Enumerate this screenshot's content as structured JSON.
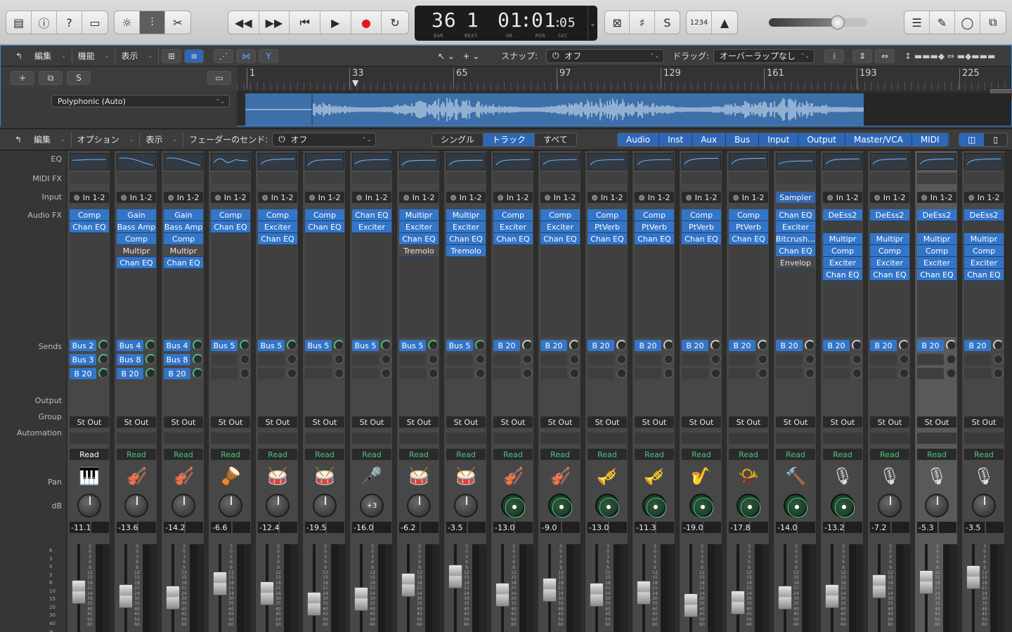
{
  "transport": {
    "bar": "36",
    "beat": "1",
    "time_hr": "01",
    "time_min": "01",
    "time_sec": "05",
    "label_bar": "BAR",
    "label_beat": "BEAT",
    "label_hr": "HR",
    "label_min": "MIN",
    "label_sec": "SEC",
    "counter": "1234"
  },
  "editor_bar": {
    "edit": "編集",
    "function": "機能",
    "view": "表示",
    "snap_label": "スナップ:",
    "snap_value": "オフ",
    "drag_label": "ドラッグ:",
    "drag_value": "オーバーラップなし"
  },
  "ruler": [
    "1",
    "33",
    "65",
    "97",
    "129",
    "161",
    "193",
    "225"
  ],
  "track": {
    "mode": "Polyphonic (Auto)",
    "s": "S"
  },
  "mixer_bar": {
    "edit": "編集",
    "options": "オプション",
    "view": "表示",
    "fader_send_label": "フェーダーのセンド:",
    "fader_send_value": "オフ",
    "views": [
      "シングル",
      "トラック",
      "すべて"
    ],
    "active_view": 1,
    "filters": [
      "Audio",
      "Inst",
      "Aux",
      "Bus",
      "Input",
      "Output",
      "Master/VCA",
      "MIDI"
    ]
  },
  "row_labels": {
    "eq": "EQ",
    "midifx": "MIDI FX",
    "input": "Input",
    "audiofx": "Audio FX",
    "sends": "Sends",
    "output": "Output",
    "group": "Group",
    "automation": "Automation",
    "pan": "Pan",
    "db": "dB"
  },
  "fader_scale": [
    "6",
    "3",
    "0",
    "3",
    "6",
    "10",
    "15",
    "20",
    "30",
    "40",
    "∞"
  ],
  "strip_scale": [
    "3",
    "0",
    "3",
    "6",
    "9",
    "12",
    "15",
    "18",
    "21",
    "24",
    "30",
    "35",
    "40",
    "45",
    "50",
    "60"
  ],
  "strips": [
    {
      "input": "In 1-2",
      "fx": [
        "Comp",
        "Chan EQ"
      ],
      "gray": [],
      "sends": [
        "Bus 2",
        "Bus 3",
        "B 20"
      ],
      "output": "St Out",
      "auto": "Read",
      "icon": "🎹",
      "pan": "",
      "pan_type": "knob",
      "db": "-11.1",
      "fader": 0.55,
      "auto_white": true
    },
    {
      "input": "In 1-2",
      "fx": [
        "Gain",
        "Bass Amp",
        "Comp",
        "Multipr",
        "Chan EQ"
      ],
      "gray": [
        3
      ],
      "sends": [
        "Bus 4",
        "Bus 8",
        "B 20"
      ],
      "output": "St Out",
      "auto": "Read",
      "icon": "🎻",
      "pan": "",
      "pan_type": "knob",
      "db": "-13.6",
      "fader": 0.62,
      "auto_white": false
    },
    {
      "input": "In 1-2",
      "fx": [
        "Gain",
        "Bass Amp",
        "Comp",
        "Multipr",
        "Chan EQ"
      ],
      "gray": [
        3
      ],
      "sends": [
        "Bus 4",
        "Bus 8",
        "B 20"
      ],
      "output": "St Out",
      "auto": "Read",
      "icon": "🎻",
      "pan": "",
      "pan_type": "knob",
      "db": "-14.2",
      "fader": 0.64,
      "auto_white": false
    },
    {
      "input": "In 1-2",
      "fx": [
        "Comp",
        "Chan EQ"
      ],
      "gray": [],
      "sends": [
        "Bus 5"
      ],
      "output": "St Out",
      "auto": "Read",
      "icon": "🪘",
      "pan": "",
      "pan_type": "knob",
      "db": "-6.6",
      "fader": 0.42,
      "auto_white": false
    },
    {
      "input": "In 1-2",
      "fx": [
        "Comp",
        "Exciter",
        "Chan EQ"
      ],
      "gray": [],
      "sends": [
        "Bus 5"
      ],
      "output": "St Out",
      "auto": "Read",
      "icon": "🥁",
      "pan": "",
      "pan_type": "knob",
      "db": "-12.4",
      "fader": 0.58,
      "auto_white": false
    },
    {
      "input": "In 1-2",
      "fx": [
        "Comp",
        "Chan EQ"
      ],
      "gray": [],
      "sends": [
        "Bus 5"
      ],
      "output": "St Out",
      "auto": "Read",
      "icon": "🥁",
      "pan": "",
      "pan_type": "knob",
      "db": "-19.5",
      "fader": 0.74,
      "auto_white": false
    },
    {
      "input": "In 1-2",
      "fx": [
        "Chan EQ",
        "Exciter"
      ],
      "gray": [],
      "sends": [
        "Bus 5"
      ],
      "output": "St Out",
      "auto": "Read",
      "icon": "🎤",
      "pan": "+3",
      "pan_type": "knob",
      "db": "-16.0",
      "fader": 0.66,
      "auto_white": false
    },
    {
      "input": "In 1-2",
      "fx": [
        "Multipr",
        "Exciter",
        "Chan EQ",
        "Tremolo"
      ],
      "gray": [
        3
      ],
      "sends": [
        "Bus 5"
      ],
      "output": "St Out",
      "auto": "Read",
      "icon": "🥁",
      "pan": "",
      "pan_type": "knob",
      "db": "-6.2",
      "fader": 0.45,
      "auto_white": false
    },
    {
      "input": "In 1-2",
      "fx": [
        "Multipr",
        "Exciter",
        "Chan EQ",
        "Tremolo"
      ],
      "gray": [],
      "sends": [
        "Bus 5"
      ],
      "output": "St Out",
      "auto": "Read",
      "icon": "🥁",
      "pan": "",
      "pan_type": "knob",
      "db": "-3.5",
      "fader": 0.32,
      "auto_white": false
    },
    {
      "input": "In 1-2",
      "fx": [
        "Comp",
        "Exciter",
        "Chan EQ"
      ],
      "gray": [],
      "sends": [
        "B 20"
      ],
      "output": "St Out",
      "auto": "Read",
      "icon": "🎻",
      "pan": "",
      "pan_type": "sur",
      "db": "-13.0",
      "fader": 0.6,
      "auto_white": false
    },
    {
      "input": "In 1-2",
      "fx": [
        "Comp",
        "Exciter",
        "Chan EQ"
      ],
      "gray": [],
      "sends": [
        "B 20"
      ],
      "output": "St Out",
      "auto": "Read",
      "icon": "🎻",
      "pan": "",
      "pan_type": "sur",
      "db": "-9.0",
      "fader": 0.52,
      "auto_white": false
    },
    {
      "input": "In 1-2",
      "fx": [
        "Comp",
        "PtVerb",
        "Chan EQ"
      ],
      "gray": [],
      "sends": [
        "B 20"
      ],
      "output": "St Out",
      "auto": "Read",
      "icon": "🎺",
      "pan": "",
      "pan_type": "sur",
      "db": "-13.0",
      "fader": 0.6,
      "auto_white": false
    },
    {
      "input": "In 1-2",
      "fx": [
        "Comp",
        "PtVerb",
        "Chan EQ"
      ],
      "gray": [],
      "sends": [
        "B 20"
      ],
      "output": "St Out",
      "auto": "Read",
      "icon": "🎺",
      "pan": "",
      "pan_type": "sur",
      "db": "-11.3",
      "fader": 0.56,
      "auto_white": false
    },
    {
      "input": "In 1-2",
      "fx": [
        "Comp",
        "PtVerb",
        "Chan EQ"
      ],
      "gray": [],
      "sends": [
        "B 20"
      ],
      "output": "St Out",
      "auto": "Read",
      "icon": "🎷",
      "pan": "",
      "pan_type": "sur",
      "db": "-19.0",
      "fader": 0.76,
      "auto_white": false
    },
    {
      "input": "In 1-2",
      "fx": [
        "Comp",
        "PtVerb",
        "Chan EQ"
      ],
      "gray": [],
      "sends": [
        "B 20"
      ],
      "output": "St Out",
      "auto": "Read",
      "icon": "📯",
      "pan": "",
      "pan_type": "sur",
      "db": "-17.8",
      "fader": 0.72,
      "auto_white": false
    },
    {
      "input": "Sampler",
      "fx": [
        "Chan EQ",
        "Exciter",
        "Bitcrush…",
        "Chan EQ",
        "Envelop"
      ],
      "gray": [
        4
      ],
      "sends": [
        "B 20"
      ],
      "output": "St Out",
      "auto": "Read",
      "icon": "🔨",
      "pan": "",
      "pan_type": "sur",
      "db": "-14.0",
      "fader": 0.64,
      "auto_white": false,
      "input_blue": true
    },
    {
      "input": "In 1-2",
      "fx": [
        "DeEss2",
        "",
        "Multipr",
        "Comp",
        "Exciter",
        "Chan EQ"
      ],
      "gray": [],
      "sends": [
        "B 20"
      ],
      "output": "St Out",
      "auto": "Read",
      "icon": "🎙",
      "pan": "",
      "pan_type": "sur",
      "db": "-13.2",
      "fader": 0.62,
      "auto_white": false
    },
    {
      "input": "In 1-2",
      "fx": [
        "DeEss2",
        "",
        "Multipr",
        "Comp",
        "Exciter",
        "Chan EQ"
      ],
      "gray": [],
      "sends": [
        "B 20"
      ],
      "output": "St Out",
      "auto": "Read",
      "icon": "🎙",
      "pan": "",
      "pan_type": "knob",
      "db": "-7.2",
      "fader": 0.47,
      "auto_white": false
    },
    {
      "input": "In 1-2",
      "fx": [
        "DeEss2",
        "",
        "Multipr",
        "Comp",
        "Exciter",
        "Chan EQ"
      ],
      "gray": [],
      "sends": [
        "B 20"
      ],
      "output": "St Out",
      "auto": "Read",
      "icon": "🎙",
      "pan": "",
      "pan_type": "knob",
      "db": "-5.3",
      "fader": 0.4,
      "auto_white": false,
      "selected": true
    },
    {
      "input": "In 1-2",
      "fx": [
        "DeEss2",
        "",
        "Multipr",
        "Comp",
        "Exciter",
        "Chan EQ"
      ],
      "gray": [],
      "sends": [
        "B 20"
      ],
      "output": "St Out",
      "auto": "Read",
      "icon": "🎙",
      "pan": "",
      "pan_type": "knob",
      "db": "-3.5",
      "fader": 0.33,
      "auto_white": false
    }
  ]
}
